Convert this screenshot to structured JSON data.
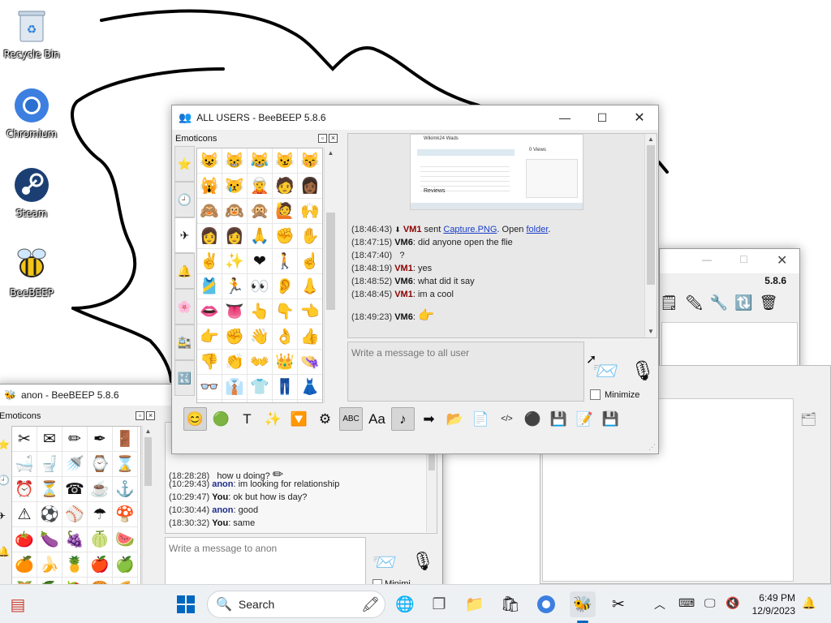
{
  "desktop": {
    "icons": [
      {
        "label": "Recycle Bin"
      },
      {
        "label": "Chromium"
      },
      {
        "label": "Steam"
      },
      {
        "label": "BeeBEEP"
      }
    ]
  },
  "main_window": {
    "title": "ALL USERS - BeeBEEP 5.8.6",
    "emoticons_panel_title": "Emoticons",
    "emoji_tabs": [
      "⭐",
      "🕘",
      "✈",
      "🔔",
      "🌸",
      "🚉",
      "🔣"
    ],
    "emoji_grid": [
      "😺",
      "😸",
      "😹",
      "😼",
      "😽",
      "🙀",
      "😿",
      "🧝",
      "🧑",
      "👩🏾",
      "🙈",
      "🙉",
      "🙊",
      "🙋",
      "🙌",
      "👩",
      "👩",
      "🙏",
      "✊",
      "✋",
      "✌",
      "✨",
      "❤",
      "🚶",
      "☝",
      "🎽",
      "🏃",
      "👀",
      "👂",
      "👃",
      "👄",
      "👅",
      "👆",
      "👇",
      "👈",
      "👉",
      "✊",
      "👋",
      "👌",
      "👍",
      "👎",
      "👏",
      "👐",
      "👑",
      "👒",
      "👓",
      "👔",
      "👕",
      "👖",
      "👗",
      "👘",
      "👙",
      "👚",
      "👛",
      "👜",
      "👝",
      "👞",
      "👟",
      "👠",
      "👡"
    ],
    "preview": {
      "window_title": "Wikimk24 Wads",
      "side_label": "0 Views",
      "reviews_label": "Reviews"
    },
    "messages": [
      {
        "time": "(18:46:43)",
        "user": "VM1",
        "text": "sent",
        "link1": "Capture.PNG",
        "mid": ". Open",
        "link2": "folder",
        "end": "."
      },
      {
        "time": "(18:47:15)",
        "user": "VM6",
        "text": ": did anyone open the flie"
      },
      {
        "time": "(18:47:40)",
        "user": "",
        "text": "?"
      },
      {
        "time": "(18:48:19)",
        "user": "VM1",
        "text": ": yes"
      },
      {
        "time": "(18:48:52)",
        "user": "VM6",
        "text": ": what did it say"
      },
      {
        "time": "(18:48:45)",
        "user": "VM1",
        "text": ": im a cool"
      },
      {
        "time": "(18:49:23)",
        "user": "VM6",
        "text": ":",
        "emoji": "👉"
      }
    ],
    "input_placeholder": "Write a message to all user",
    "minimize_label": "Minimize",
    "toolbar_icons": [
      "😊",
      "🟢",
      "T",
      "✨",
      "🔽",
      "⚙",
      "ABC",
      "Aa",
      "♪",
      "➡",
      "📂",
      "📄",
      "</>",
      "⚫",
      "💾",
      "📝",
      "💾"
    ]
  },
  "anon_window": {
    "title": "anon - BeeBEEP 5.8.6",
    "emoticons_panel_title": "Emoticons",
    "emoji_grid": [
      "✂",
      "✉",
      "✏",
      "✒",
      "🚪",
      "🛁",
      "🚽",
      "🚿",
      "⌚",
      "⌛",
      "⏰",
      "⏳",
      "☎",
      "☕",
      "⚓",
      "⚠",
      "⚽",
      "⚾",
      "☂",
      "🍄",
      "🍅",
      "🍆",
      "🍇",
      "🍈",
      "🍉",
      "🍊",
      "🍌",
      "🍍",
      "🍎",
      "🍏",
      "🍑",
      "🍒",
      "🍓",
      "🍔",
      "🍕"
    ],
    "messages": [
      {
        "time": "(18:28:28)",
        "user": "",
        "text": "how u doing?",
        "emoji": "✏"
      },
      {
        "time": "(10:29:43)",
        "user": "anon",
        "text": ": im looking for relationship"
      },
      {
        "time": "(10:29:47)",
        "user": "You",
        "text": ": ok but how is day?"
      },
      {
        "time": "(10:30:44)",
        "user": "anon",
        "text": ": good"
      },
      {
        "time": "(18:30:32)",
        "user": "You",
        "text": ": same"
      }
    ],
    "input_placeholder": "Write a message to anon",
    "minimize_label": "Minimi"
  },
  "back_window": {
    "title_version": "5.8.6"
  },
  "taskbar": {
    "search_label": "Search",
    "time": "6:49 PM",
    "date": "12/9/2023"
  },
  "colors": {
    "accent": "#0067c0",
    "vm1_name": "#8b0000",
    "anon_name": "#1f2e8c",
    "link": "#1a3ec8"
  }
}
